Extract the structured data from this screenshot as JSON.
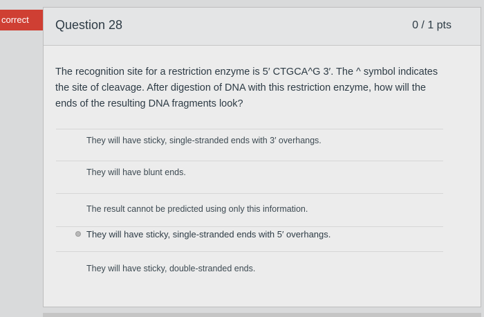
{
  "status": {
    "flag_label": "correct",
    "flag_color": "#cf3f33"
  },
  "question": {
    "title": "Question 28",
    "points": "0 / 1 pts",
    "text": "The recognition site for a restriction enzyme is 5′ CTGCA^G 3′. The ^ symbol indicates the site of cleavage. After digestion of DNA with this restriction enzyme, how will the ends of the resulting DNA fragments look?"
  },
  "answers": [
    {
      "label": "They will have sticky, single-stranded ends with 3′ overhangs.",
      "selected": false
    },
    {
      "label": "They will have blunt ends.",
      "selected": false
    },
    {
      "label": "The result cannot be predicted using only this information.",
      "selected": false
    },
    {
      "label": "They will have sticky, single-stranded ends with 5′ overhangs.",
      "selected": true
    },
    {
      "label": "They will have sticky, double-stranded ends.",
      "selected": false
    }
  ]
}
